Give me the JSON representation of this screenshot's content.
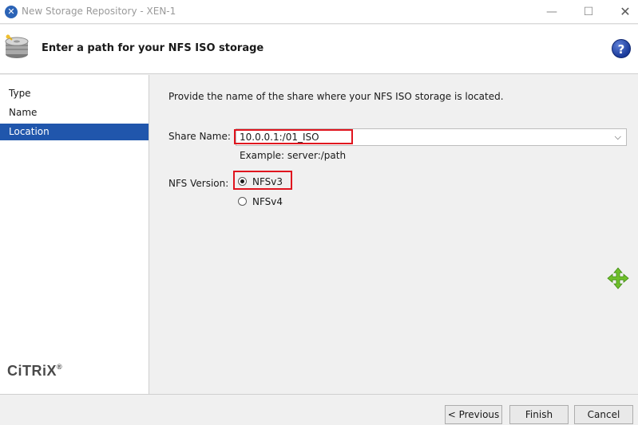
{
  "window": {
    "title": "New Storage Repository - XEN-1",
    "app_icon": "xen-icon",
    "controls": {
      "minimize": "—",
      "maximize": "☐",
      "close": "✕"
    }
  },
  "header": {
    "title": "Enter a path for your NFS ISO storage",
    "icon": "storage-disk-icon",
    "help_label": "?"
  },
  "nav": {
    "items": [
      {
        "label": "Type",
        "selected": false
      },
      {
        "label": "Name",
        "selected": false
      },
      {
        "label": "Location",
        "selected": true
      }
    ],
    "logo_text": "CiTRiX",
    "logo_mark": "®"
  },
  "main": {
    "intro": "Provide the name of the share where your NFS ISO storage is located.",
    "share_name_label": "Share Name:",
    "share_name_value": "10.0.0.1:/01_ISO",
    "example_text": "Example: server:/path",
    "nfs_version_label": "NFS Version:",
    "nfs_options": [
      {
        "label": "NFSv3",
        "checked": true
      },
      {
        "label": "NFSv4",
        "checked": false
      }
    ],
    "highlight_color": "#e0141e"
  },
  "footer": {
    "previous_label": "< Previous",
    "finish_label": "Finish",
    "cancel_label": "Cancel"
  },
  "colors": {
    "selection": "#2056ac",
    "move_icon": "#6fbf2a"
  }
}
